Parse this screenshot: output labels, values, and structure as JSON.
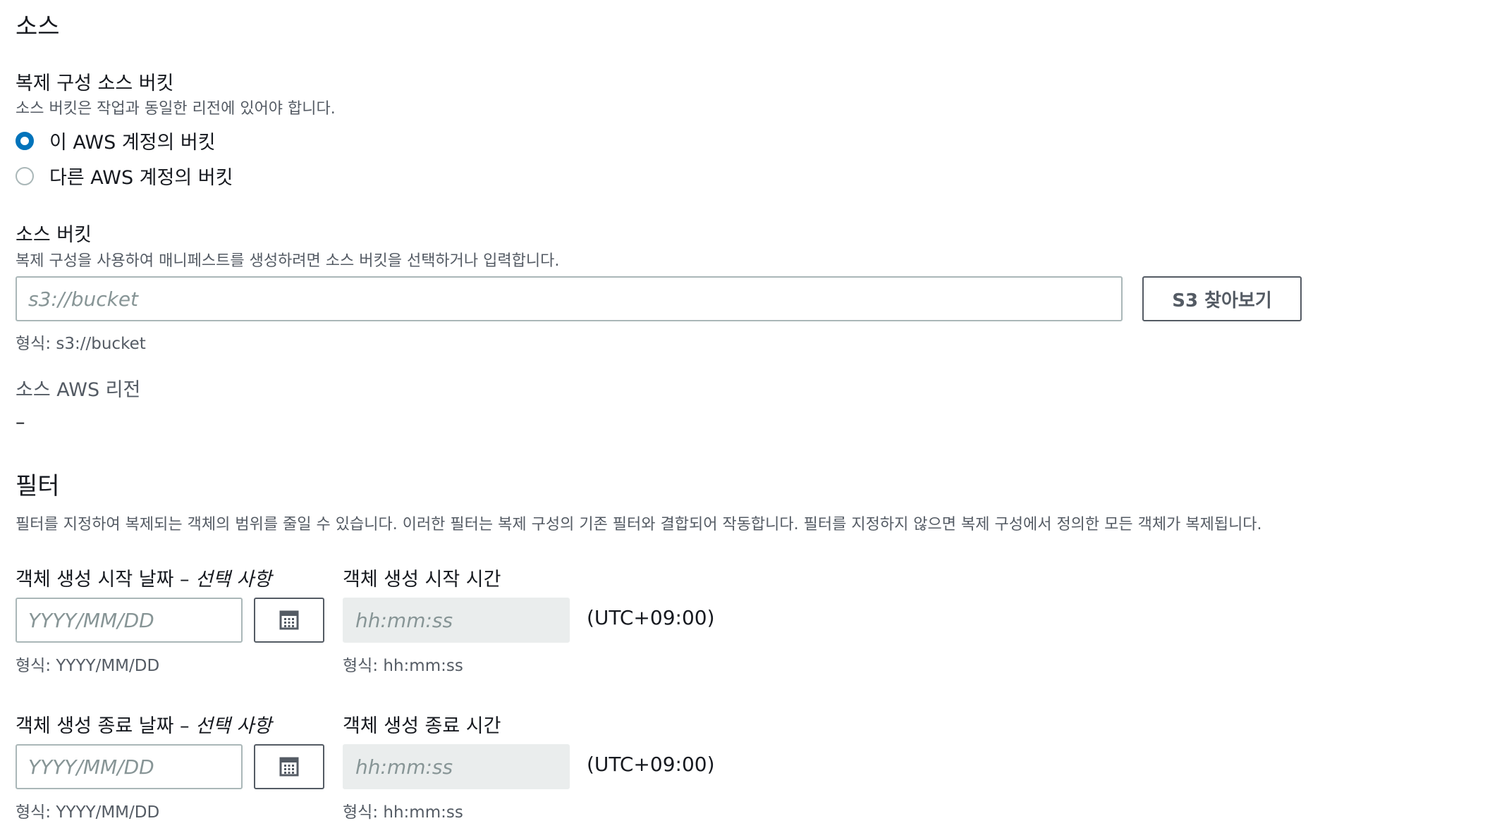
{
  "source_section": {
    "title": "소스",
    "config_bucket": {
      "label": "복제 구성 소스 버킷",
      "description": "소스 버킷은 작업과 동일한 리전에 있어야 합니다.",
      "options": [
        {
          "label": "이 AWS 계정의 버킷",
          "selected": true
        },
        {
          "label": "다른 AWS 계정의 버킷",
          "selected": false
        }
      ]
    },
    "source_bucket": {
      "label": "소스 버킷",
      "description": "복제 구성을 사용하여 매니페스트를 생성하려면 소스 버킷을 선택하거나 입력합니다.",
      "placeholder": "s3://bucket",
      "value": "",
      "browse_button": "S3 찾아보기",
      "hint": "형식: s3://bucket"
    },
    "region": {
      "label": "소스 AWS 리전",
      "value": "–"
    }
  },
  "filter_section": {
    "title": "필터",
    "description": "필터를 지정하여 복제되는 객체의 범위를 줄일 수 있습니다. 이러한 필터는 복제 구성의 기존 필터와 결합되어 작동합니다. 필터를 지정하지 않으면 복제 구성에서 정의한 모든 객체가 복제됩니다.",
    "start": {
      "date_label": "객체 생성 시작 날짜 – ",
      "date_optional": "선택 사항",
      "date_placeholder": "YYYY/MM/DD",
      "date_hint": "형식: YYYY/MM/DD",
      "time_label": "객체 생성 시작 시간",
      "time_placeholder": "hh:mm:ss",
      "time_hint": "형식: hh:mm:ss",
      "timezone": "(UTC+09:00)"
    },
    "end": {
      "date_label": "객체 생성 종료 날짜 – ",
      "date_optional": "선택 사항",
      "date_placeholder": "YYYY/MM/DD",
      "date_hint": "형식: YYYY/MM/DD",
      "time_label": "객체 생성 종료 시간",
      "time_placeholder": "hh:mm:ss",
      "time_hint": "형식: hh:mm:ss",
      "timezone": "(UTC+09:00)"
    }
  },
  "icons": {
    "calendar": "calendar-icon"
  },
  "colors": {
    "accent": "#0073bb",
    "text": "#16191f",
    "muted": "#545b64",
    "placeholder": "#879596",
    "disabled_bg": "#eaeded"
  }
}
